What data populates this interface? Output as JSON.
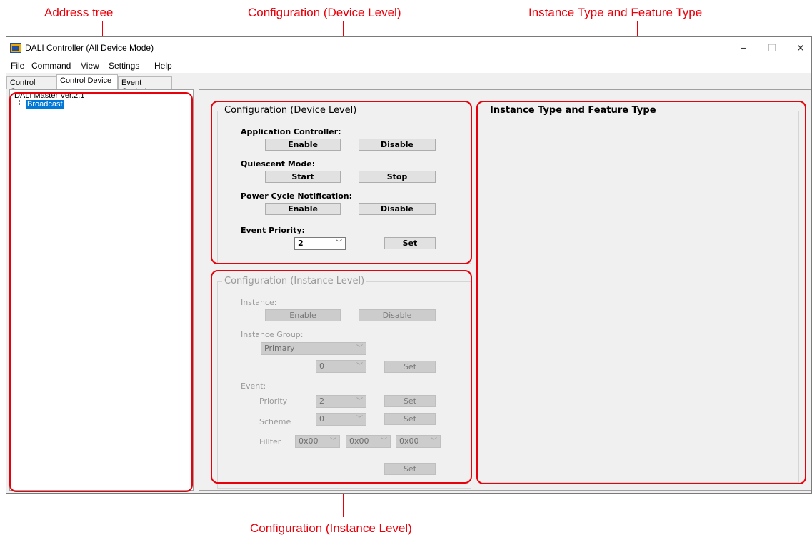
{
  "annotations": {
    "address_tree": "Address tree",
    "config_device": "Configuration (Device Level)",
    "instance_feature": "Instance Type and Feature Type",
    "config_instance": "Configuration (Instance Level)"
  },
  "window": {
    "title": "DALI Controller (All Device Mode)",
    "minimize": "−",
    "maximize": "☐",
    "close": "✕"
  },
  "menu": [
    "File",
    "Command",
    "View",
    "Settings",
    "Help"
  ],
  "tabs": [
    "Control Gear",
    "Control Device",
    "Event Control"
  ],
  "active_tab": "Control Device",
  "tree": {
    "root": "DALI Master Ver.2.1",
    "child": "Broadcast"
  },
  "device_level": {
    "title": "Configuration (Device Level)",
    "app_controller_label": "Application Controller:",
    "app_enable": "Enable",
    "app_disable": "Disable",
    "quiescent_label": "Quiescent Mode:",
    "quiescent_start": "Start",
    "quiescent_stop": "Stop",
    "power_cycle_label": "Power Cycle Notification:",
    "power_enable": "Enable",
    "power_disable": "Disable",
    "event_priority_label": "Event Priority:",
    "event_priority_value": "2",
    "set_label": "Set"
  },
  "instance_level": {
    "title": "Configuration (Instance Level)",
    "instance_label": "Instance:",
    "instance_enable": "Enable",
    "instance_disable": "Disable",
    "group_label": "Instance Group:",
    "group_value": "Primary",
    "group_number": "0",
    "group_set": "Set",
    "event_label": "Event:",
    "priority_label": "Priority",
    "priority_value": "2",
    "priority_set": "Set",
    "scheme_label": "Scheme",
    "scheme_value": "0",
    "scheme_set": "Set",
    "filter_label": "Fillter",
    "filter_values": [
      "0x00",
      "0x00",
      "0x00"
    ],
    "filter_set": "Set"
  },
  "feature_panel": {
    "title": "Instance Type and Feature Type"
  }
}
